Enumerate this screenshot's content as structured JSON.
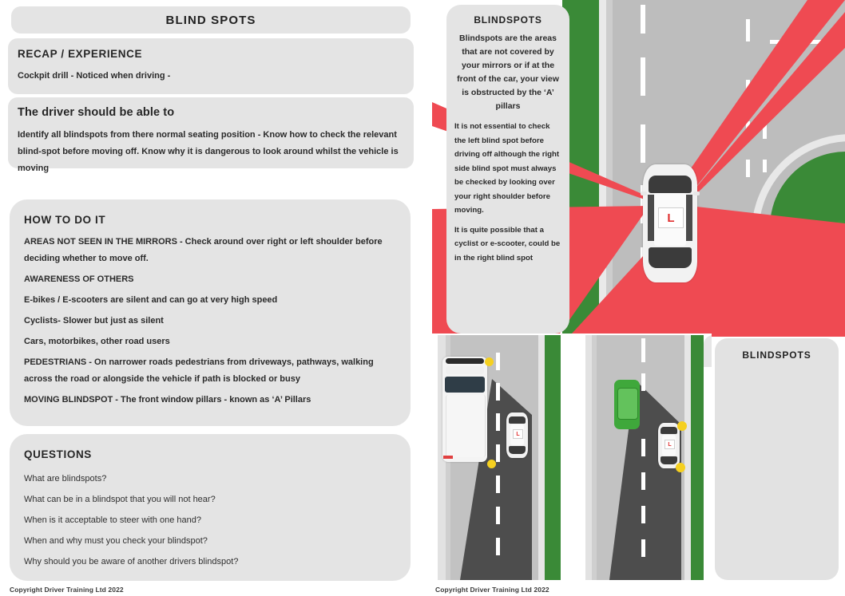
{
  "colors": {
    "card_bg": "#e4e4e4",
    "page_bg": "#ffffff",
    "blindspot_red": "#ef4a52",
    "grass_green": "#3a8a37",
    "road_grey": "#bdbdbd",
    "shadow_grey": "#4d4d4d",
    "lplate_red": "#e03030",
    "marker_yellow": "#f5d020"
  },
  "left": {
    "title": "BLIND SPOTS",
    "recap": {
      "heading": "RECAP / EXPERIENCE",
      "body": "Cockpit drill - Noticed when driving -"
    },
    "objective": {
      "heading": "The driver should be able to",
      "body": "Identify all blindspots from there normal seating position - Know how to check the relevant  blind-spot before moving off. Know why it is dangerous to look around whilst the vehicle is moving"
    },
    "howto": {
      "heading": "HOW TO DO IT",
      "lines": [
        "AREAS NOT SEEN IN THE MIRRORS - Check around over right or left shoulder before deciding whether to move off.",
        "AWARENESS OF OTHERS",
        "E-bikes / E-scooters are silent and can go at very high speed",
        "Cyclists- Slower but just as silent",
        "Cars, motorbikes, other road users",
        "PEDESTRIANS - On narrower roads pedestrians from driveways, pathways, walking across the road or alongside the vehicle if path is blocked or busy",
        "MOVING BLINDSPOT - The front window pillars - known as ‘A’ Pillars"
      ]
    },
    "questions": {
      "heading": "QUESTIONS",
      "items": [
        "What are blindspots?",
        "What can be in a blindspot that you will not hear?",
        "When is it acceptable to steer with one hand?",
        "When and why must you check your blindspot?",
        "Why should you be aware of another drivers blindspot?"
      ]
    },
    "copyright": "Copyright Driver Training Ltd 2022"
  },
  "right": {
    "panel": {
      "title": "BLINDSPOTS",
      "intro": "Blindspots are the areas that are not covered by your mirrors or if at the front of the car, your view is obstructed by the ‘A’ pillars",
      "para2": "It is not essential to check the left blind spot before driving off although the right side blind spot must always be checked by looking over your right shoulder before moving.",
      "para3": "It is quite possible that a cyclist or e-scooter, could be in the right blind spot"
    },
    "label_panel": {
      "title": "BLINDSPOTS"
    },
    "copyright": "Copyright Driver Training Ltd 2022",
    "diagrams": {
      "top": {
        "name": "learner-car-blindspot-cones-overhead",
        "vehicle_badge": "L"
      },
      "bottom_left": {
        "name": "van-blindspot-shadow-overhead",
        "vehicle_badge": "L"
      },
      "bottom_middle": {
        "name": "green-car-blindspot-shadow-overhead",
        "vehicle_badge": "L"
      }
    }
  }
}
